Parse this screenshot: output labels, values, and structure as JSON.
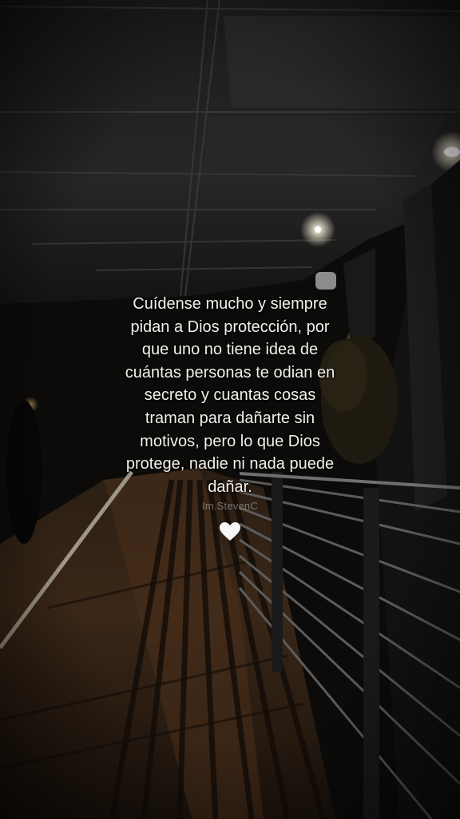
{
  "quote": {
    "lines": [
      "Cuídense mucho y siempre",
      "pidan a Dios protección, por",
      "que uno no tiene idea de",
      "cuántas personas te odian en",
      "secreto y cuantas cosas",
      "traman para dañarte sin",
      "motivos, pero lo que Dios",
      "protege, nadie ni nada puede",
      "dañar."
    ]
  },
  "watermark": "Im.StevenC",
  "heart_icon": "white-heart-icon",
  "colors": {
    "text": "#f4f1ec",
    "background": "#0b0a09",
    "light": "#fff6dc"
  }
}
